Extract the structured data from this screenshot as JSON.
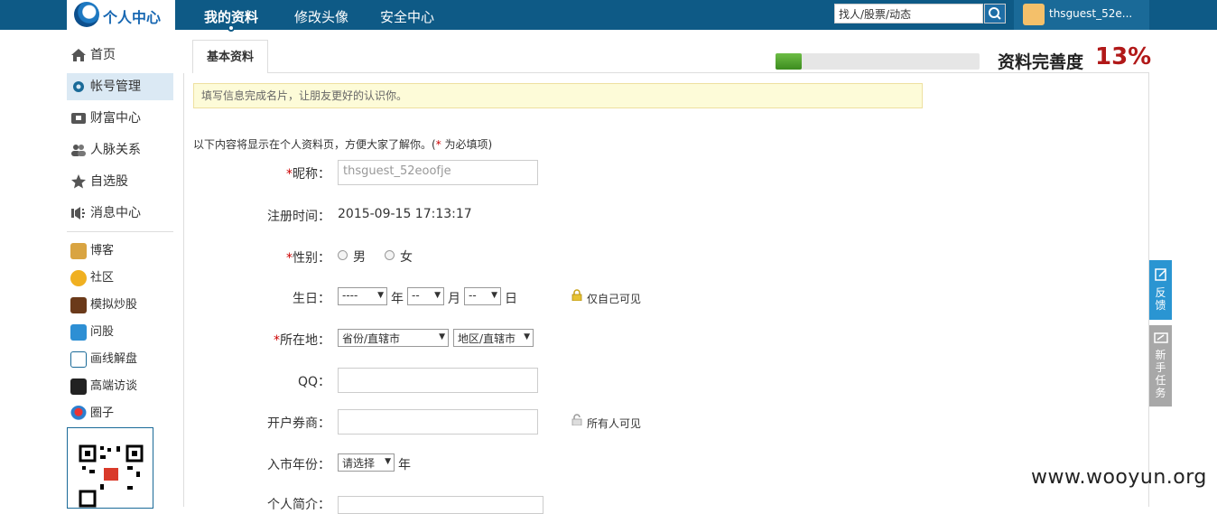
{
  "header": {
    "logo_text": "个人中心",
    "nav": [
      "我的资料",
      "修改头像",
      "安全中心"
    ],
    "search_placeholder": "找人/股票/动态",
    "username": "thsguest_52e..."
  },
  "sidebar": {
    "items": [
      "首页",
      "帐号管理",
      "财富中心",
      "人脉关系",
      "自选股",
      "消息中心"
    ],
    "apps": [
      "博客",
      "社区",
      "模拟炒股",
      "问股",
      "画线解盘",
      "高端访谈",
      "圈子"
    ]
  },
  "main": {
    "tab": "基本资料",
    "progress_label": "资料完善度",
    "progress_value": "13%",
    "progress_fraction": 0.13,
    "notice": "填写信息完成名片，让朋友更好的认识你。",
    "intro_prefix": "以下内容将显示在个人资料页，方便大家了解你。(",
    "intro_req": "*",
    "intro_suffix": " 为必填项)"
  },
  "form": {
    "req_mark": "*",
    "nickname_label": "昵称：",
    "nickname_value": "thsguest_52eoofje",
    "regtime_label": "注册时间：",
    "regtime_value": "2015-09-15 17:13:17",
    "gender_label": "性别：",
    "gender_male": "男",
    "gender_female": "女",
    "birthday_label": "生日：",
    "year_select": "----",
    "year_unit": "年",
    "month_select": "--",
    "month_unit": "月",
    "day_select": "--",
    "day_unit": "日",
    "private_note": "仅自己可见",
    "location_label": "所在地：",
    "province_select": "省份/直辖市",
    "region_select": "地区/直辖市",
    "qq_label": "QQ：",
    "broker_label": "开户券商：",
    "public_note": "所有人可见",
    "market_year_label": "入市年份：",
    "market_year_select": "请选择",
    "market_year_unit": "年",
    "bio_label": "个人简介："
  },
  "float": {
    "feedback": "反馈",
    "newbie": "新手任务"
  },
  "watermark": "www.wooyun.org"
}
